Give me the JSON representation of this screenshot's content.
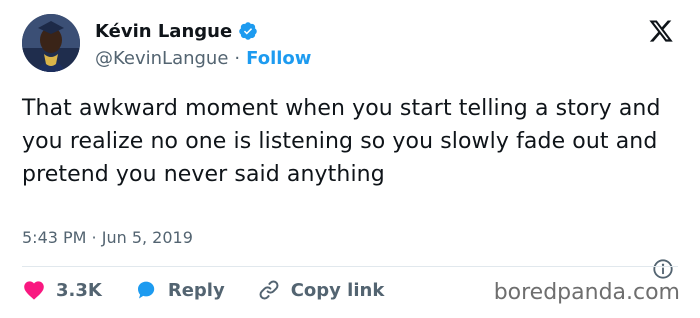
{
  "author": {
    "name": "Kévin Langue",
    "handle": "@KevinLangue",
    "separator": "·",
    "follow_label": "Follow"
  },
  "icons": {
    "verified": "verified-badge-icon",
    "platform": "x-logo-icon",
    "info": "info-icon",
    "like": "heart-icon",
    "reply": "reply-bubble-icon",
    "copy": "link-icon"
  },
  "tweet": {
    "text": "That awkward moment when you start telling a story and you realize no one is listening so you slowly fade out and pretend you never said anything"
  },
  "meta": {
    "time": "5:43 PM",
    "separator": " · ",
    "date": "Jun 5, 2019"
  },
  "actions": {
    "likes": "3.3K",
    "reply_label": "Reply",
    "copy_label": "Copy link"
  },
  "watermark": "boredpanda.com",
  "colors": {
    "accent": "#1d9bf0",
    "like": "#f91880",
    "text": "#0f1419",
    "muted": "#536471"
  }
}
